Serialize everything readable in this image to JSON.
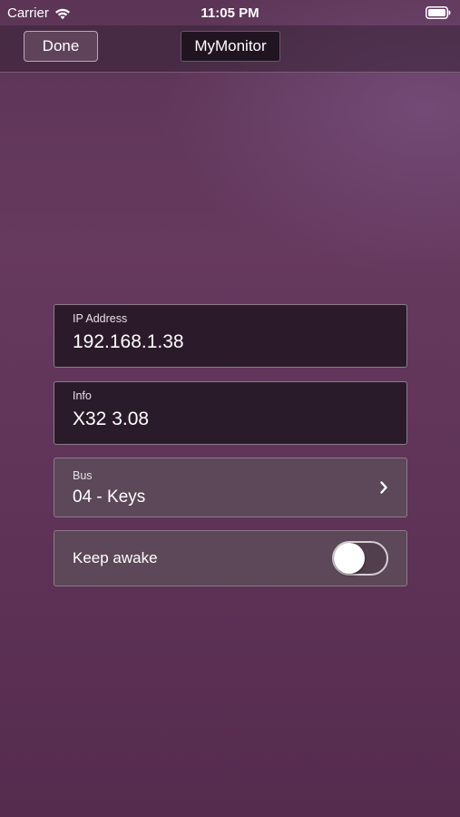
{
  "status_bar": {
    "carrier": "Carrier",
    "time": "11:05 PM",
    "wifi_icon": "wifi-icon",
    "battery_icon": "battery-icon"
  },
  "nav": {
    "done_label": "Done",
    "title": "MyMonitor"
  },
  "form": {
    "ip": {
      "label": "IP Address",
      "value": "192.168.1.38"
    },
    "info": {
      "label": "Info",
      "value": "X32 3.08"
    },
    "bus": {
      "label": "Bus",
      "value": "04 - Keys",
      "icon": "chevron-right-icon"
    },
    "keep_awake": {
      "label": "Keep awake",
      "on": false
    }
  },
  "colors": {
    "background": "#64375e",
    "field_dark": "#251825",
    "field_light": "#5c4a58"
  }
}
